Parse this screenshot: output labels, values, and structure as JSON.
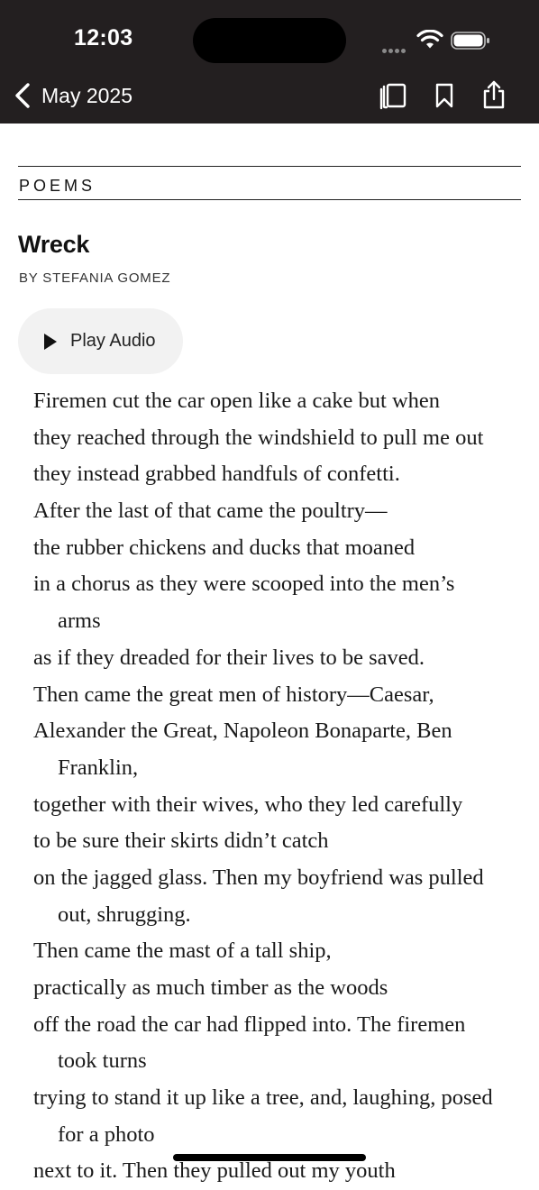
{
  "status_bar": {
    "time": "12:03"
  },
  "nav": {
    "back_label": "May 2025",
    "icons": [
      "chevron-left-icon",
      "table-of-contents-icon",
      "bookmark-icon",
      "share-icon"
    ]
  },
  "article": {
    "section": "POEMS",
    "title": "Wreck",
    "byline": "BY STEFANIA GOMEZ",
    "play_audio_label": "Play Audio",
    "lines": [
      "Firemen cut the car open like a cake but when",
      "they reached through the windshield to pull me out",
      "they instead grabbed handfuls of confetti.",
      "After the last of that came the poultry—",
      "the rubber chickens and ducks that moaned",
      "in a chorus as they were scooped into the men’s",
      "arms",
      "as if they dreaded for their lives to be saved.",
      "Then came the great men of history—Caesar,",
      "Alexander the Great, Napoleon Bonaparte, Ben",
      "Franklin,",
      "together with their wives, who they led carefully",
      "to be sure their skirts didn’t catch",
      "on the jagged glass. Then my boyfriend was pulled",
      "out, shrugging.",
      "Then came the mast of a tall ship,",
      "practically as much timber as the woods",
      "off the road the car had flipped into. The firemen",
      "took turns",
      "trying to stand it up like a tree, and, laughing, posed",
      "for a photo",
      "next to it. Then they pulled out my youth"
    ]
  },
  "colors": {
    "header_bg": "#231f20",
    "play_button_bg": "#f2f2f2"
  }
}
